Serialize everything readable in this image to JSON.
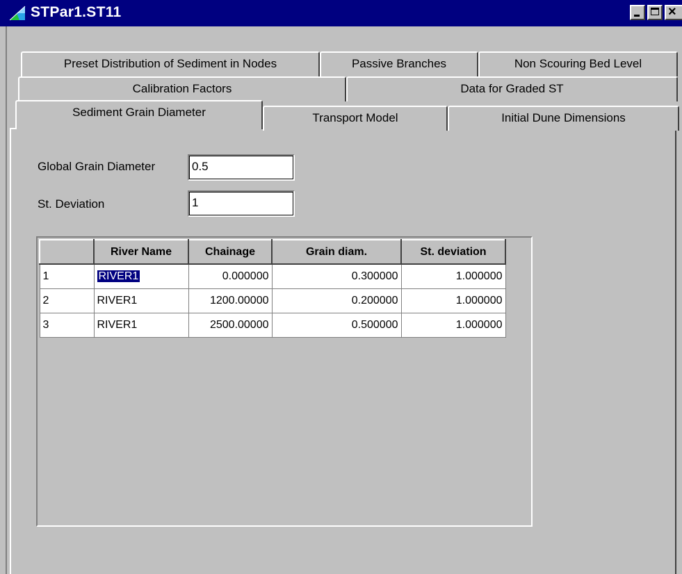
{
  "window": {
    "title": "STPar1.ST11",
    "icon": "app-icon",
    "controls": {
      "minimize": "minimize-icon",
      "maximize": "maximize-icon",
      "close": "×"
    }
  },
  "tabs": {
    "row1": [
      "Preset Distribution of Sediment in Nodes",
      "Passive Branches",
      "Non Scouring Bed Level"
    ],
    "row2": [
      "Calibration Factors",
      "Data for Graded ST"
    ],
    "row3": [
      "Sediment Grain Diameter",
      "Transport Model",
      "Initial Dune Dimensions"
    ],
    "active": "Sediment Grain Diameter"
  },
  "form": {
    "global_grain_label": "Global Grain Diameter",
    "global_grain_value": "0.5",
    "st_deviation_label": "St. Deviation",
    "st_deviation_value": "1"
  },
  "grid": {
    "columns": [
      "",
      "River Name",
      "Chainage",
      "Grain diam.",
      "St. deviation"
    ],
    "rows": [
      {
        "index": "1",
        "river": "RIVER1",
        "chainage": "0.000000",
        "grain": "0.300000",
        "stdev": "1.000000"
      },
      {
        "index": "2",
        "river": "RIVER1",
        "chainage": "1200.00000",
        "grain": "0.200000",
        "stdev": "1.000000"
      },
      {
        "index": "3",
        "river": "RIVER1",
        "chainage": "2500.00000",
        "grain": "0.500000",
        "stdev": "1.000000"
      }
    ]
  },
  "colors": {
    "titlebar": "#000080",
    "face": "#c0c0c0",
    "selection": "#000080"
  }
}
